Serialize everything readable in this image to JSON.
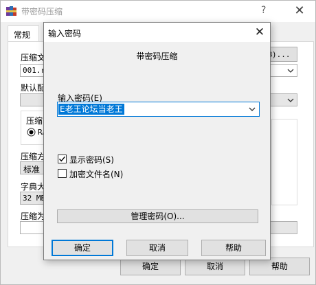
{
  "main_window": {
    "title": "带密码压缩",
    "help_glyph": "?",
    "close_glyph": "✕",
    "tab_general": "常规",
    "frag_archive_label": "压缩文",
    "frag_archive_value": "001.ra",
    "frag_browse": "B)...",
    "frag_default_label": "默认配",
    "frag_format_label": "压缩",
    "frag_format_value": "RA",
    "frag_method_label": "压缩方",
    "frag_method_value": "标准",
    "frag_dict_label": "字典大",
    "frag_dict_value": "32 MB",
    "frag_volume_label": "压缩为",
    "ok_button": "确定",
    "cancel_button": "取消",
    "help_button": "帮助"
  },
  "password_dialog": {
    "title": "输入密码",
    "close_glyph": "✕",
    "heading": "带密码压缩",
    "password_label": "输入密码(E)",
    "password_value": "E老王论坛当老王",
    "show_password": {
      "label": "显示密码(S)",
      "checked": true
    },
    "encrypt_names": {
      "label": "加密文件名(N)",
      "checked": false
    },
    "manage_button": "管理密码(O)...",
    "ok_button": "确定",
    "cancel_button": "取消",
    "help_button": "帮助"
  },
  "colors": {
    "accent": "#0078d7",
    "window_bg": "#f0f0f0",
    "selection_text": "#ffffff"
  }
}
